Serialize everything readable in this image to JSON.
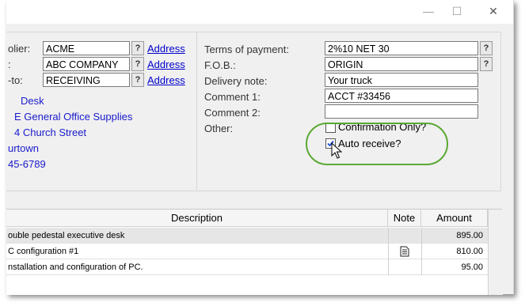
{
  "window": {
    "minimize_glyph": "—",
    "maximize_glyph": "☐",
    "close_glyph": "✕"
  },
  "vendor": {
    "supplier_label": "olier:",
    "supplier_value": "ACME",
    "ship_label": ":",
    "ship_value": "ABC COMPANY",
    "shipto_label": "-to:",
    "shipto_value": "RECEIVING",
    "lookup_glyph": "?",
    "address_link": "Address",
    "address_lines": [
      "Desk",
      "E General Office Supplies",
      "4 Church Street",
      "urtown",
      "45-6789"
    ]
  },
  "order": {
    "terms_label": "Terms of payment:",
    "terms_value": "2%10 NET 30",
    "fob_label": "F.O.B.:",
    "fob_value": "ORIGIN",
    "delivery_label": "Delivery note:",
    "delivery_value": "Your truck",
    "comment1_label": "Comment 1:",
    "comment1_value": "ACCT #33456",
    "comment2_label": "Comment 2:",
    "comment2_value": "",
    "other_label": "Other:",
    "confirmation_label": "Confirmation Only?",
    "confirmation_checked": false,
    "auto_receive_label": "Auto receive?",
    "auto_receive_checked": true
  },
  "table": {
    "columns": [
      "Description",
      "Note",
      "Amount"
    ],
    "rows": [
      {
        "description": "ouble pedestal executive desk",
        "note_icon": "",
        "amount": "895.00"
      },
      {
        "description": "C configuration #1",
        "note_icon": "document-icon",
        "amount": "810.00"
      },
      {
        "description": "nstallation and configuration of PC.",
        "note_icon": "",
        "amount": "95.00"
      }
    ]
  },
  "colors": {
    "link": "#0000cc",
    "highlight_oval": "#5aa832",
    "selected_row": "#e6e6e6"
  }
}
